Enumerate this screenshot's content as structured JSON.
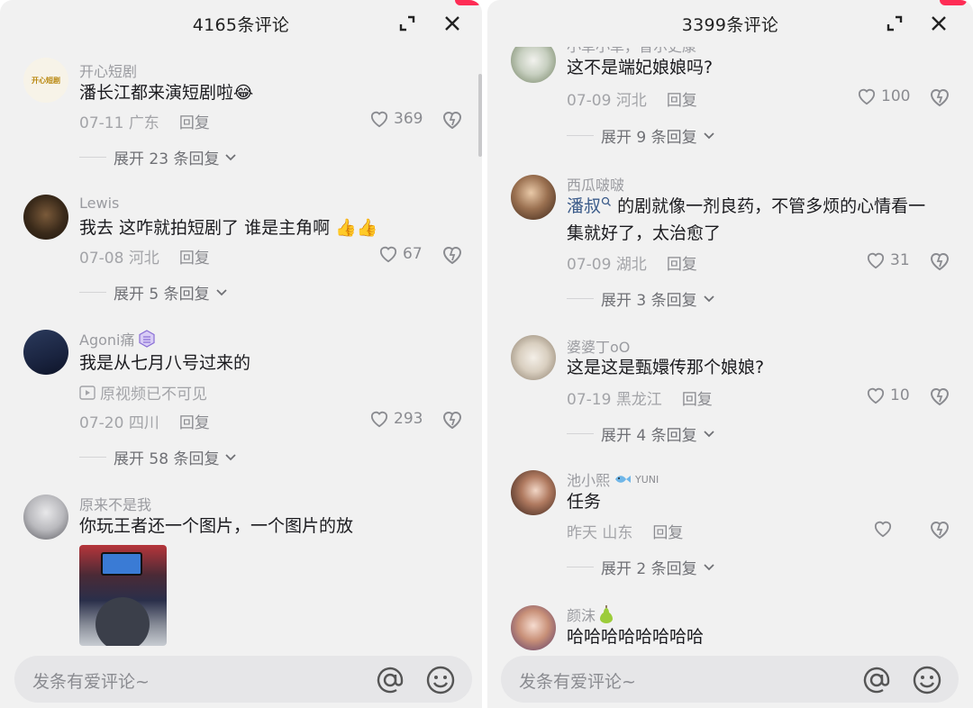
{
  "left": {
    "header": {
      "title": "4165条评论"
    },
    "comments": [
      {
        "user": "开心短剧",
        "avatar_text": "开心短剧",
        "text": "潘长江都来演短剧啦",
        "emoji": "😂",
        "date": "07-11",
        "location": "广东",
        "reply": "回复",
        "likes": "369",
        "expand": "展开 23 条回复"
      },
      {
        "user": "Lewis",
        "text": "我去 这咋就拍短剧了 谁是主角啊",
        "emoji": "👍👍",
        "date": "07-08",
        "location": "河北",
        "reply": "回复",
        "likes": "67",
        "expand": "展开 5 条回复"
      },
      {
        "user": "Agoni痛",
        "text": "我是从七月八号过来的",
        "note": "原视频已不可见",
        "date": "07-20",
        "location": "四川",
        "reply": "回复",
        "likes": "293",
        "expand": "展开 58 条回复"
      },
      {
        "user": "原来不是我",
        "text": "你玩王者还一个图片，一个图片的放"
      }
    ],
    "input": {
      "placeholder": "发条有爱评论~"
    }
  },
  "right": {
    "header": {
      "title": "3399条评论"
    },
    "cut_user": "小草小草，普尔史康",
    "comments": [
      {
        "text": "这不是端妃娘娘吗?",
        "date": "07-09",
        "location": "河北",
        "reply": "回复",
        "likes": "100",
        "expand": "展开 9 条回复"
      },
      {
        "user": "西瓜啵啵",
        "mention": "潘叔",
        "text_line1": "的剧就像一剂良药，不管多烦的心情看一",
        "text_line2": "集就好了，太治愈了",
        "date": "07-09",
        "location": "湖北",
        "reply": "回复",
        "likes": "31",
        "expand": "展开 3 条回复"
      },
      {
        "user": "婆婆丁oO",
        "text": "这是这是甄嬛传那个娘娘?",
        "date": "07-19",
        "location": "黑龙江",
        "reply": "回复",
        "likes": "10",
        "expand": "展开 4 条回复"
      },
      {
        "user": "池小熙",
        "badge": "YUNI",
        "text": "任务",
        "date": "昨天",
        "location": "山东",
        "reply": "回复",
        "expand": "展开 2 条回复"
      },
      {
        "user": "颜沫",
        "text": "哈哈哈哈哈哈哈哈"
      }
    ],
    "input": {
      "placeholder": "发条有爱评论~"
    }
  },
  "colors": {
    "panel_bg": "#f1f1f1",
    "accent": "#fe2c55",
    "mention": "#3b5b8a"
  }
}
